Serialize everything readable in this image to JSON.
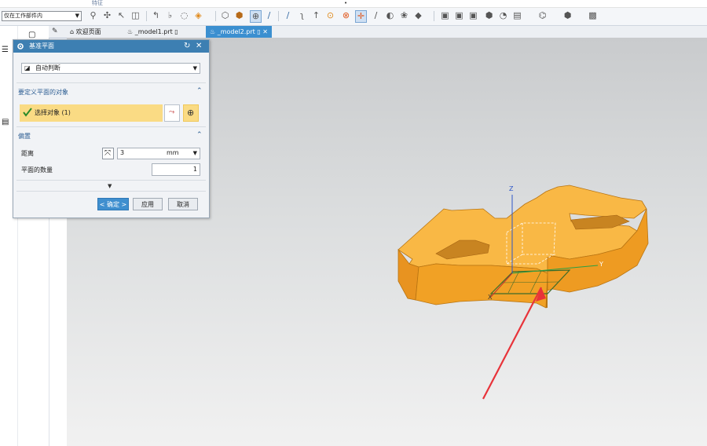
{
  "topbar": {
    "label": "特征",
    "marker": "•"
  },
  "toolbar": {
    "filter_value": "仅在工作部件内",
    "icons": [
      "filter-icon",
      "point-icon",
      "vector-icon",
      "select-icon",
      "snap-icon",
      "point-on-curve-icon",
      "end-point-icon",
      "cube-icon",
      "body-icon",
      "intersection-icon",
      "line-icon",
      "curve-icon",
      "tangent-icon",
      "arrow-up-icon",
      "center-icon",
      "circle-icon",
      "cross-icon",
      "arc-icon",
      "point-icon",
      "node-icon",
      "view-icon",
      "fit-icon",
      "orient-icon",
      "render-icon",
      "layer-icon",
      "show-icon",
      "camera-icon",
      "settings-icon"
    ]
  },
  "tabs": [
    {
      "label": "欢迎页面",
      "icon": "home-icon"
    },
    {
      "label": "_model1.prt",
      "icon": "part-icon"
    },
    {
      "label": "_model2.prt",
      "icon": "part-icon",
      "active": true
    }
  ],
  "dialog": {
    "title": "基准平面",
    "type_value": "自动判断",
    "section1_title": "要定义平面的对象",
    "select_label": "选择对象 (1)",
    "section2_title": "偏置",
    "distance_label": "距离",
    "distance_value": "3",
    "distance_unit": "mm",
    "count_label": "平面的数量",
    "count_value": "1",
    "ok_label": "< 确定 >",
    "apply_label": "应用",
    "cancel_label": "取消"
  },
  "viewport": {
    "axis_z": "Z",
    "axis_y": "Y",
    "axis_x": "X",
    "part_color": "#f5a623",
    "arrow_color": "#e8333a"
  }
}
